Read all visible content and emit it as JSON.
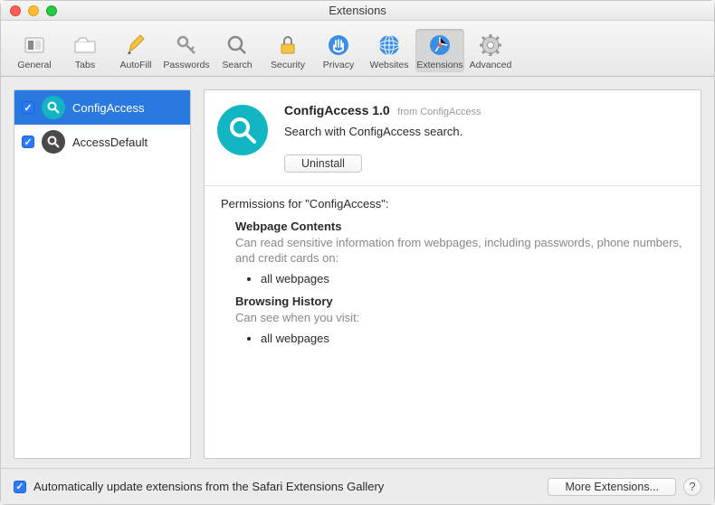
{
  "window_title": "Extensions",
  "toolbar": {
    "general": "General",
    "tabs": "Tabs",
    "autofill": "AutoFill",
    "passwords": "Passwords",
    "search": "Search",
    "security": "Security",
    "privacy": "Privacy",
    "websites": "Websites",
    "extensions": "Extensions",
    "advanced": "Advanced"
  },
  "sidebar": {
    "items": [
      {
        "name": "ConfigAccess",
        "checked": true,
        "selected": true,
        "icon_color": "#12b6c2"
      },
      {
        "name": "AccessDefault",
        "checked": true,
        "selected": false,
        "icon_color": "#4a4a4a"
      }
    ]
  },
  "detail": {
    "title": "ConfigAccess 1.0",
    "from": "from ConfigAccess",
    "description": "Search with ConfigAccess search.",
    "uninstall_label": "Uninstall",
    "permissions_header": "Permissions for \"ConfigAccess\":",
    "sections": [
      {
        "heading": "Webpage Contents",
        "desc": "Can read sensitive information from webpages, including passwords, phone numbers, and credit cards on:",
        "bullets": [
          "all webpages"
        ]
      },
      {
        "heading": "Browsing History",
        "desc": "Can see when you visit:",
        "bullets": [
          "all webpages"
        ]
      }
    ]
  },
  "footer": {
    "auto_update_label": "Automatically update extensions from the Safari Extensions Gallery",
    "auto_update_checked": true,
    "more_extensions_label": "More Extensions...",
    "help": "?"
  }
}
